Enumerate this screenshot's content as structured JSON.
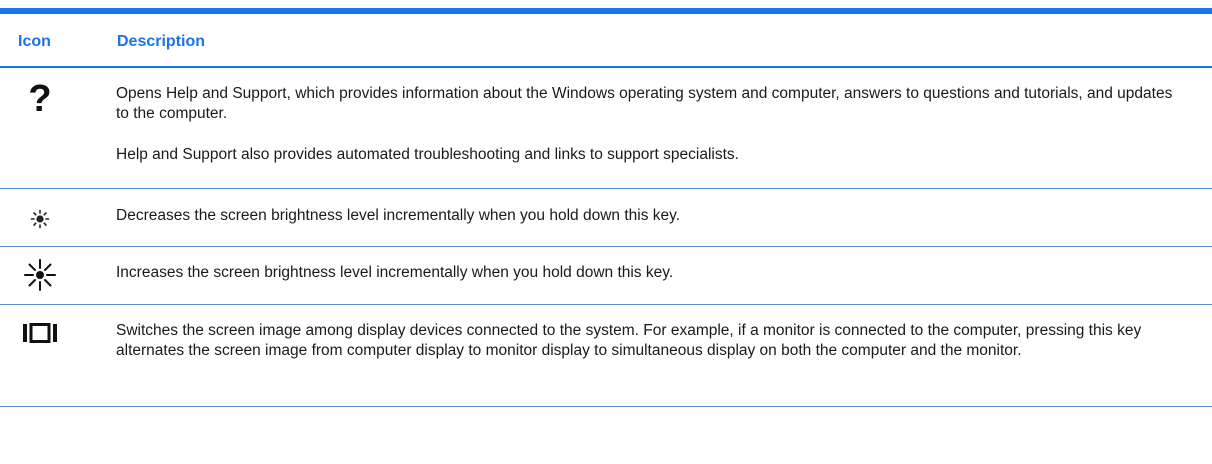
{
  "table": {
    "header": {
      "icon": "Icon",
      "description": "Description"
    },
    "rows": [
      {
        "icon": "help-question-icon",
        "icon_glyph": "?",
        "paragraphs": [
          "Opens Help and Support, which provides information about the Windows operating system and computer, answers to questions and tutorials, and updates to the computer.",
          "Help and Support also provides automated troubleshooting and links to support specialists."
        ]
      },
      {
        "icon": "brightness-down-icon",
        "paragraphs": [
          "Decreases the screen brightness level incrementally when you hold down this key."
        ]
      },
      {
        "icon": "brightness-up-icon",
        "paragraphs": [
          "Increases the screen brightness level incrementally when you hold down this key."
        ]
      },
      {
        "icon": "display-switch-icon",
        "paragraphs": [
          "Switches the screen image among display devices connected to the system. For example, if a monitor is connected to the computer, pressing this key alternates the screen image from computer display to monitor display to simultaneous display on both the computer and the monitor."
        ]
      }
    ]
  },
  "colors": {
    "accent": "#1a73e8",
    "row_rule": "#5b8fd6",
    "text": "#1a1a1a"
  }
}
